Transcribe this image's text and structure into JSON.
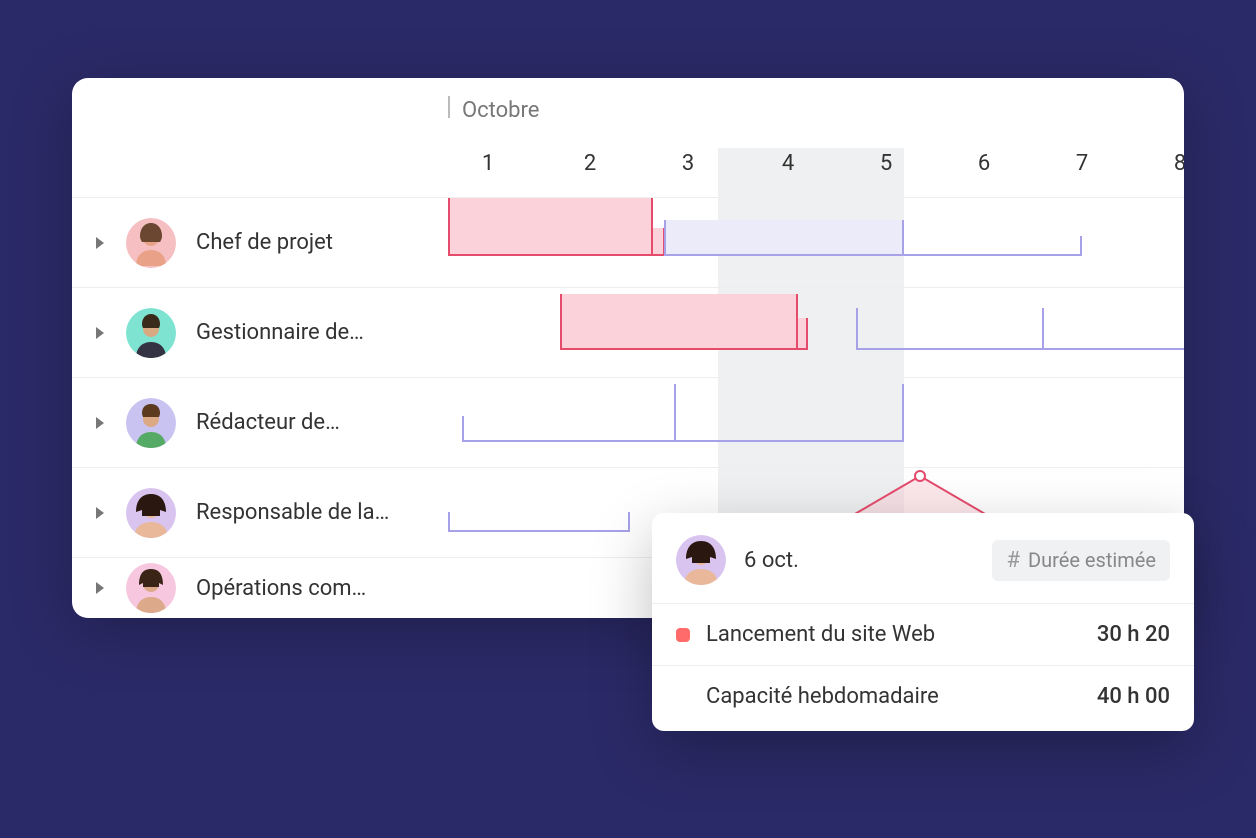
{
  "month_label": "Octobre",
  "days": [
    "1",
    "2",
    "3",
    "4",
    "5",
    "6",
    "7",
    "8"
  ],
  "roles": [
    {
      "label": "Chef de projet",
      "avatar_bg": "#f6bfc1"
    },
    {
      "label": "Gestionnaire de…",
      "avatar_bg": "#7fe3d2"
    },
    {
      "label": "Rédacteur de…",
      "avatar_bg": "#c9c3f2"
    },
    {
      "label": "Responsable de la…",
      "avatar_bg": "#d9c4f0"
    },
    {
      "label": "Opérations com…",
      "avatar_bg": "#f6c7df"
    }
  ],
  "tooltip": {
    "date": "6 oct.",
    "tag_label": "Durée estimée",
    "rows": [
      {
        "label": "Lancement du site Web",
        "value": "30 h 20",
        "dot": true
      },
      {
        "label": "Capacité hebdomadaire",
        "value": "40 h 00",
        "dot": false
      }
    ]
  }
}
